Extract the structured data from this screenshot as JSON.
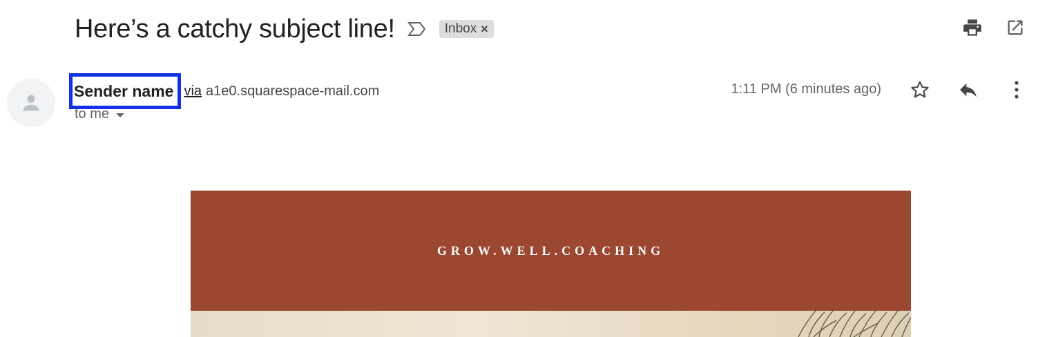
{
  "email": {
    "subject": "Here’s a catchy subject line!",
    "label": "Inbox",
    "label_remove": "×",
    "sender_name": "Sender name",
    "via": "via",
    "sender_domain": "a1e0.squarespace-mail.com",
    "recipient": "to me",
    "timestamp": "1:11 PM (6 minutes ago)"
  },
  "body": {
    "brand": "GROW.WELL.COACHING"
  },
  "icons": {
    "important": "important-marker-icon",
    "print": "print-icon",
    "open_new_window": "open-in-new-window-icon",
    "avatar": "person-icon",
    "recipient_details": "chevron-down-icon",
    "star": "star-icon",
    "reply": "reply-icon",
    "more": "more-vert-icon"
  },
  "colors": {
    "banner": "#9b4732",
    "highlight_box": "#1331e5",
    "chip": "#dddddd"
  }
}
